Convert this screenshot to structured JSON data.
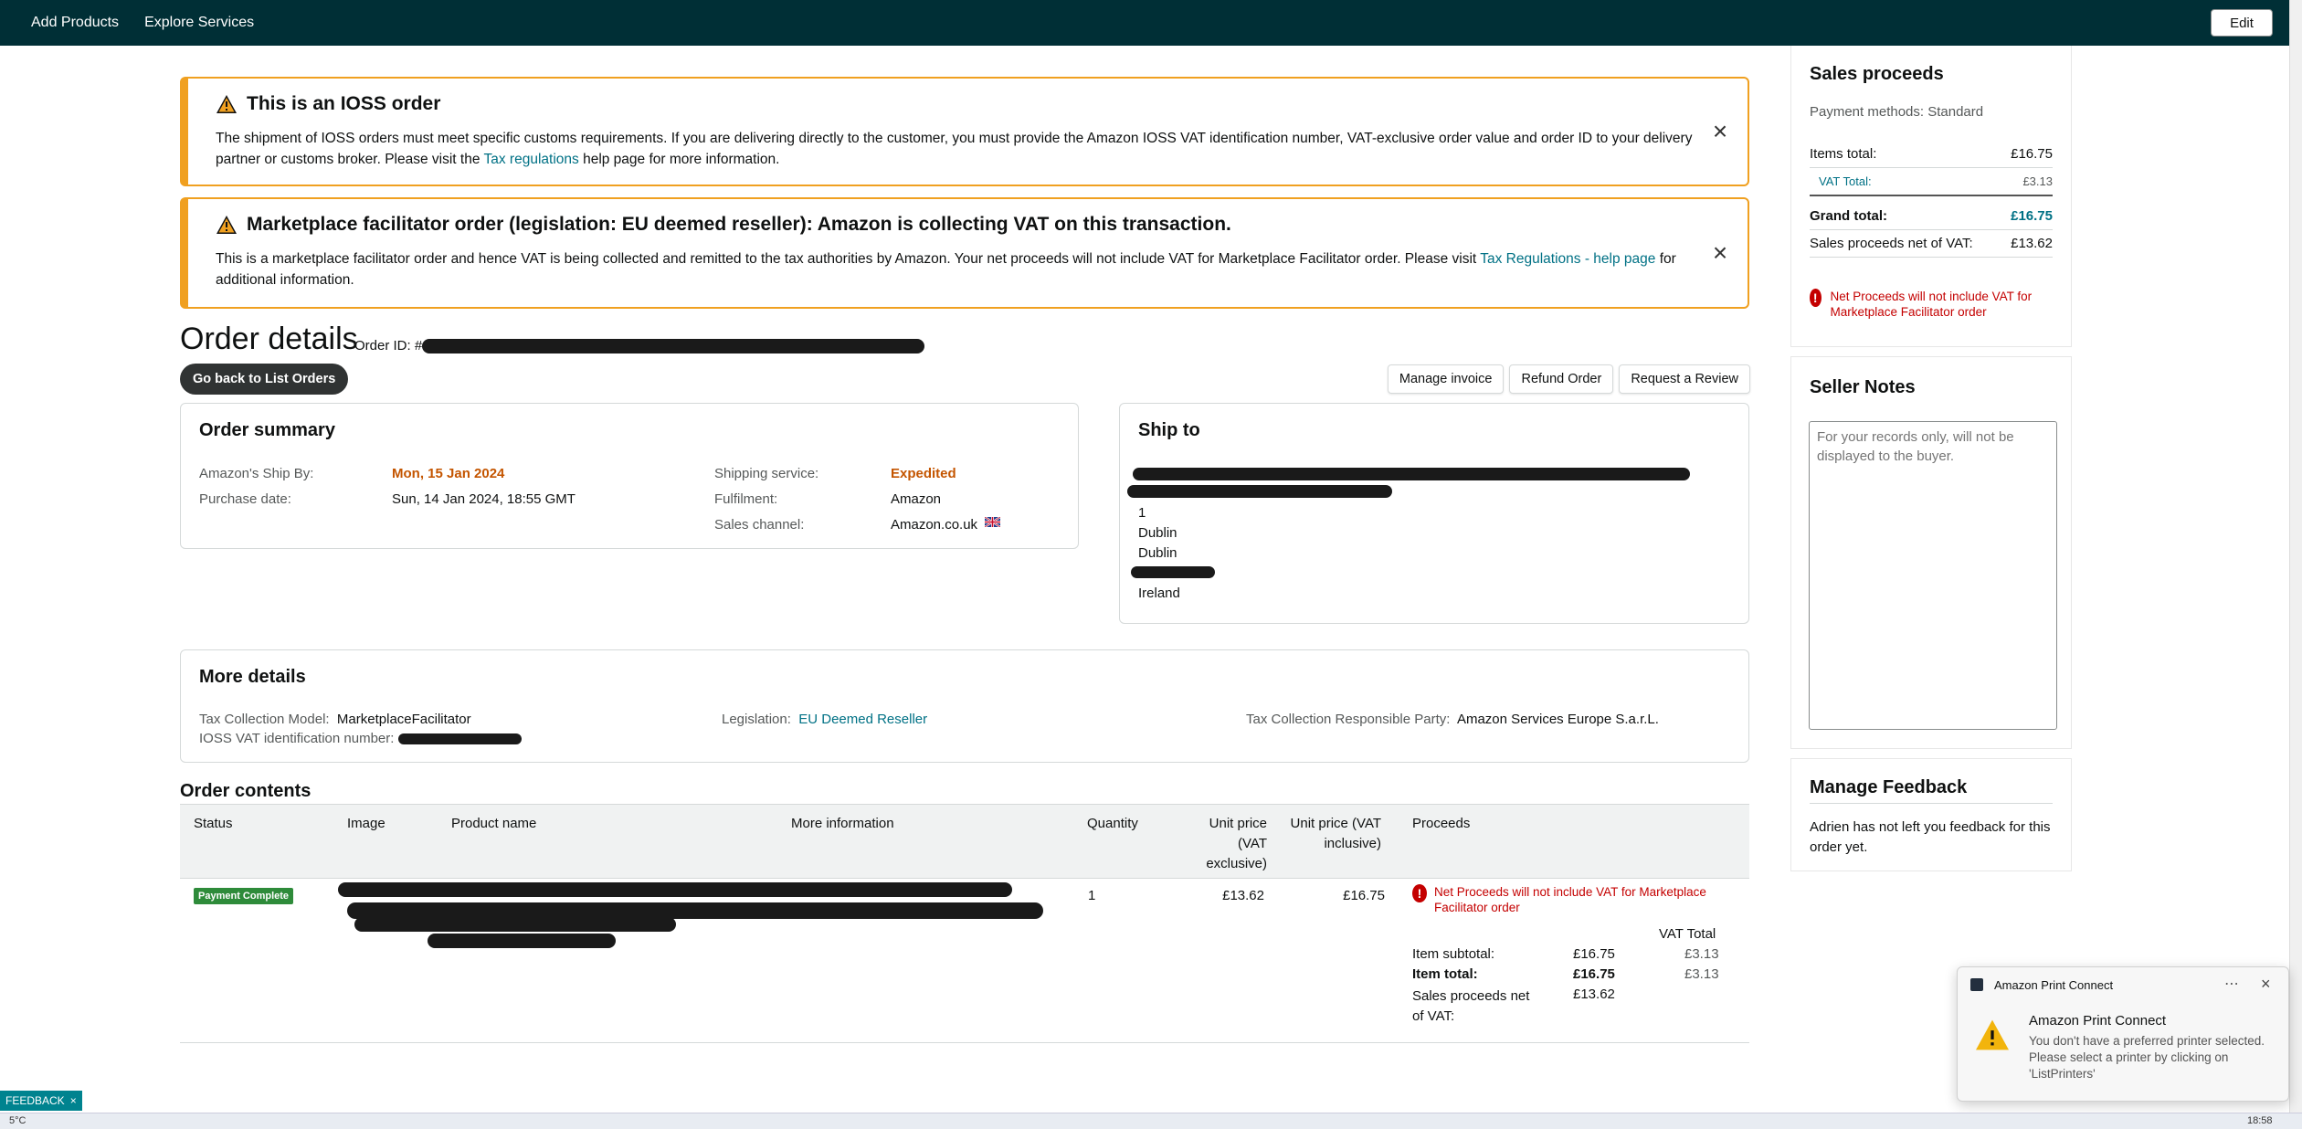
{
  "nav": {
    "items": [
      "Add Products",
      "Explore Services"
    ],
    "edit": "Edit"
  },
  "alerts": [
    {
      "title": "This is an IOSS order",
      "body_pre": "The shipment of IOSS orders must meet specific customs requirements. If you are delivering directly to the customer, you must provide the Amazon IOSS VAT identification number, VAT-exclusive order value and order ID to your delivery partner or customs broker. Please visit the ",
      "link": "Tax regulations",
      "body_post": " help page for more information.",
      "close": "×"
    },
    {
      "title": "Marketplace facilitator order (legislation: EU deemed reseller): Amazon is collecting VAT on this transaction.",
      "body_pre": "This is a marketplace facilitator order and hence VAT is being collected and remitted to the tax authorities by Amazon. Your net proceeds will not include VAT for Marketplace Facilitator order. Please visit ",
      "link": "Tax Regulations - help page",
      "body_post": " for additional information.",
      "close": "×"
    }
  ],
  "order": {
    "title": "Order details",
    "id_label": "Order ID: #",
    "back": "Go back to List Orders",
    "actions": [
      "Manage invoice",
      "Refund Order",
      "Request a Review"
    ]
  },
  "summary": {
    "title": "Order summary",
    "ship_by_label": "Amazon's Ship By:",
    "ship_by": "Mon, 15 Jan 2024",
    "purchase_label": "Purchase date:",
    "purchase": "Sun, 14 Jan 2024, 18:55 GMT",
    "shipping_label": "Shipping service:",
    "shipping": "Expedited",
    "fulfilment_label": "Fulfilment:",
    "fulfilment": "Amazon",
    "channel_label": "Sales channel:",
    "channel": "Amazon.co.uk"
  },
  "ship_to": {
    "title": "Ship to",
    "lines": [
      "1",
      "Dublin",
      "Dublin"
    ],
    "country": "Ireland"
  },
  "more_details": {
    "title": "More details",
    "tcm_label": "Tax Collection Model:",
    "tcm": "MarketplaceFacilitator",
    "ioss_label": "IOSS VAT identification number:",
    "leg_label": "Legislation:",
    "leg": "EU Deemed Reseller",
    "party_label": "Tax Collection Responsible Party:",
    "party": "Amazon Services Europe S.a.r.L."
  },
  "contents": {
    "title": "Order contents",
    "headers": {
      "status": "Status",
      "image": "Image",
      "product": "Product name",
      "more": "More information",
      "qty": "Quantity",
      "up_ex": "Unit price (VAT exclusive)",
      "up_inc": "Unit price (VAT inclusive)",
      "proceeds": "Proceeds"
    },
    "row": {
      "status": "Payment Complete",
      "qty": "1",
      "up_ex": "£13.62",
      "up_inc": "£16.75",
      "warning": "Net Proceeds will not include VAT for Marketplace Facilitator order",
      "vat_total_header": "VAT Total",
      "subtotal_label": "Item subtotal:",
      "subtotal": "£16.75",
      "subtotal_vat": "£3.13",
      "total_label": "Item total:",
      "total": "£16.75",
      "total_vat": "£3.13",
      "net_label": "Sales proceeds net of VAT:",
      "net": "£13.62"
    }
  },
  "sidebar": {
    "proceeds_title": "Sales proceeds",
    "payment_methods": "Payment methods: Standard",
    "items_total_label": "Items total:",
    "items_total": "£16.75",
    "vat_total_label": "VAT Total:",
    "vat_total": "£3.13",
    "grand_total_label": "Grand total:",
    "grand_total": "£16.75",
    "net_label": "Sales proceeds net of VAT:",
    "net": "£13.62",
    "warning": "Net Proceeds will not include VAT for Marketplace Facilitator order",
    "notes_title": "Seller Notes",
    "notes_placeholder": "For your records only, will not be displayed to the buyer.",
    "feedback_title": "Manage Feedback",
    "feedback_text": "Adrien has not left you feedback for this order yet."
  },
  "toast": {
    "app": "Amazon Print Connect",
    "title": "Amazon Print Connect",
    "message": "You don't have a preferred printer selected. Please select a printer by clicking on 'ListPrinters'"
  },
  "feedback_tab": "FEEDBACK",
  "taskbar": {
    "temp": "5°C",
    "time": "18:58"
  },
  "colors": {
    "nav_bg": "#002f36",
    "alert_border": "#f0a020",
    "link": "#007185",
    "orange": "#c45500",
    "error": "#c40000",
    "badge_green": "#2e8b3a"
  }
}
